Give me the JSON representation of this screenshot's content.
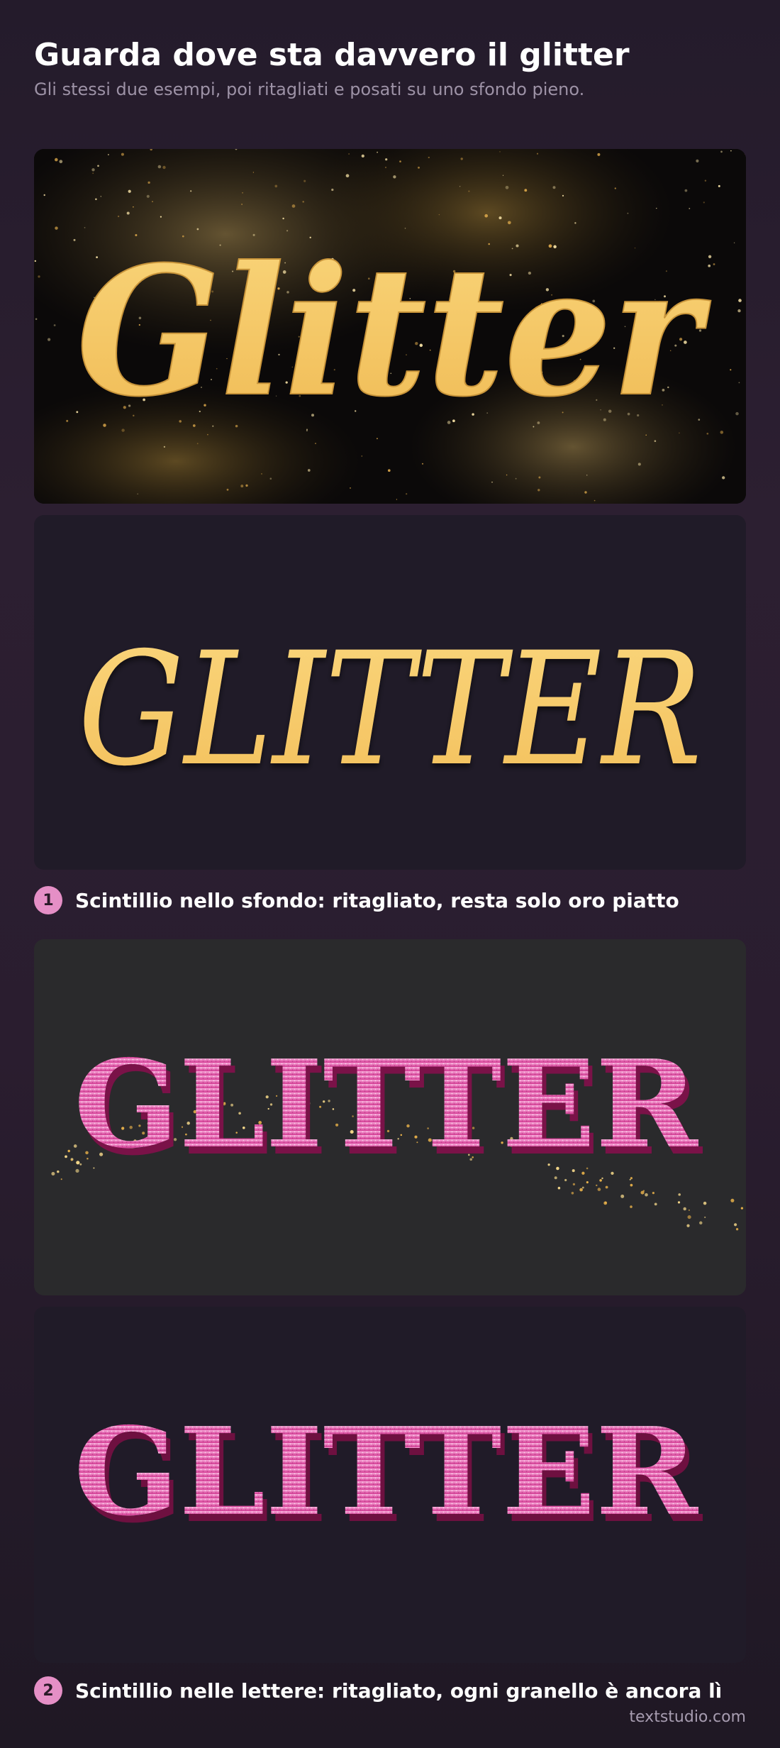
{
  "header": {
    "title": "Guarda dove sta davvero il glitter",
    "subtitle": "Gli stessi due esempi, poi ritagliati e posati su uno sfondo pieno."
  },
  "examples": [
    {
      "badge": "1",
      "caption": "Scintillio nello sfondo: ritagliato, resta solo oro piatto",
      "original_word": "Glitter",
      "cropped_word": "GLITTER",
      "color": "#f5c865"
    },
    {
      "badge": "2",
      "caption": "Scintillio nelle lettere: ritagliato, ogni granello è ancora lì",
      "original_word": "GLITTER",
      "cropped_word": "GLITTER",
      "color": "#e0509f"
    }
  ],
  "footer": {
    "brand": "textstudio.com"
  },
  "colors": {
    "background": "#241b2b",
    "gold": "#f5c865",
    "pink": "#e0509f",
    "badge": "#e58fc6"
  }
}
